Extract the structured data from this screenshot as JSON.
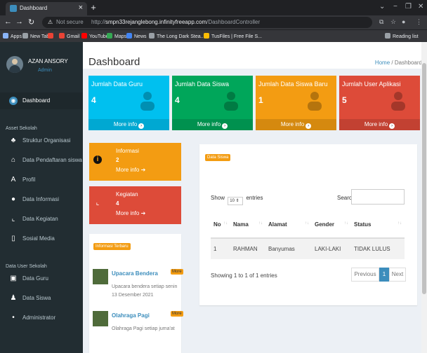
{
  "browser": {
    "tab_title": "Dashboard",
    "tab_close": "×",
    "new_tab": "+",
    "not_secure": "Not secure",
    "url_prefix": "http://",
    "url_host": "smpn33rejanglebong.infinityfreeapp.com",
    "url_path": "/DashboardController",
    "bookmarks": [
      {
        "label": "Apps",
        "color": "#8ab4f8"
      },
      {
        "label": "New Tab",
        "color": "#9aa0a6"
      },
      {
        "label": "",
        "color": "#ea4335"
      },
      {
        "label": "Gmail",
        "color": "#ea4335"
      },
      {
        "label": "YouTube",
        "color": "#ff0000"
      },
      {
        "label": "Maps",
        "color": "#34a853"
      },
      {
        "label": "News",
        "color": "#4285f4"
      },
      {
        "label": "The Long Dark Stea...",
        "color": "#9aa0a6"
      },
      {
        "label": "TusFiles | Free File S...",
        "color": "#fbbc04"
      }
    ],
    "reading_list": "Reading list"
  },
  "sidebar": {
    "user_name": "AZAN ANSORY",
    "user_status": "Admin",
    "items": [
      {
        "label": "Dashboard",
        "icon": "dashboard-icon",
        "glyph": "◉",
        "active": true
      },
      {
        "header": "Asset Sekolah"
      },
      {
        "label": "Struktur Organisasi",
        "icon": "sitemap-icon",
        "glyph": "♣"
      },
      {
        "label": "Data Pendaftaran siswa",
        "icon": "bank-icon",
        "glyph": "⌂"
      },
      {
        "label": "Profil",
        "icon": "font-icon",
        "glyph": "A"
      },
      {
        "label": "Data Informasi",
        "icon": "info-icon",
        "glyph": "●"
      },
      {
        "label": "Data Kegiatan",
        "icon": "chart-icon",
        "glyph": "⌞"
      },
      {
        "label": "Sosial Media",
        "icon": "bar-chart-icon",
        "glyph": "▯"
      },
      {
        "header": "Data User Sekolah"
      },
      {
        "label": "Data Guru",
        "icon": "id-card-icon",
        "glyph": "▣"
      },
      {
        "label": "Data Siswa",
        "icon": "user-icon",
        "glyph": "♟"
      },
      {
        "label": "Administrator",
        "icon": "users-icon",
        "glyph": "•"
      }
    ]
  },
  "header": {
    "title": "Dashboard",
    "breadcrumb_home": "Home",
    "breadcrumb_sep": "/",
    "breadcrumb_current": "Dashboard"
  },
  "stats": [
    {
      "title": "Jumlah Data Guru",
      "value": "4",
      "footer": "More info",
      "color": "#00c0ef",
      "icon": "graduation-cap-icon"
    },
    {
      "title": "Jumlah Data Siswa",
      "value": "4",
      "footer": "More info",
      "color": "#00a65a",
      "icon": "users-icon"
    },
    {
      "title": "Jumlah Data Siswa Baru",
      "value": "1",
      "footer": "More info",
      "color": "#f39c12",
      "icon": "user-plus-icon"
    },
    {
      "title": "Jumlah User Aplikasi",
      "value": "5",
      "footer": "More info",
      "color": "#dd4b39",
      "icon": "users-icon"
    }
  ],
  "widgets": [
    {
      "title": "Informasi",
      "count": "2",
      "link": "More info",
      "color": "#f39c12",
      "icon": "info-circle-icon",
      "glyph": "i"
    },
    {
      "title": "Kegiatan",
      "count": "4",
      "link": "More info",
      "color": "#dd4b39",
      "icon": "line-chart-icon",
      "glyph": "⌞"
    }
  ],
  "news": {
    "label": "Informasi Terbaru",
    "more_label": "More",
    "items": [
      {
        "title": "Upacara Bendera",
        "desc": "Upacara bendera setiap senin 13 Desember 2021"
      },
      {
        "title": "Olahraga Pagi",
        "desc": "Olahraga Pagi setiap juma'at"
      }
    ]
  },
  "table": {
    "label": "Data Siswa",
    "show": "Show",
    "entries_value": "10",
    "entries": "entries",
    "search_label": "Search:",
    "columns": [
      "No",
      "Nama",
      "Alamat",
      "Gender",
      "Status"
    ],
    "sort_glyph": "↑↓",
    "rows": [
      [
        "1",
        "RAHMAN",
        "Banyumas",
        "LAKI-LAKI",
        "TIDAK LULUS"
      ]
    ],
    "info": "Showing 1 to 1 of 1 entries",
    "prev": "Previous",
    "page": "1",
    "next": "Next"
  }
}
